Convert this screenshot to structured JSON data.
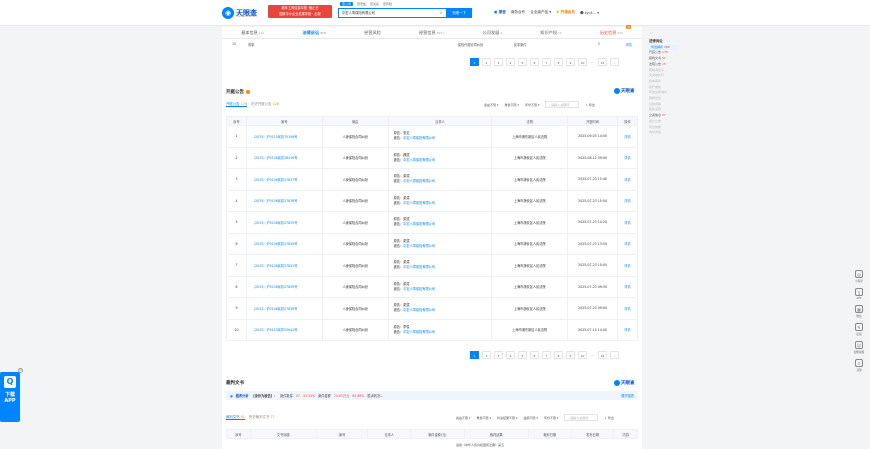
{
  "header": {
    "logo": "天眼查",
    "logo_sub": "TianYancha.com",
    "promo_line1": "新年工商信息年报 ·截止日",
    "promo_line2": "国家中小企业发展年报 · 必报",
    "search_tabs": [
      "查公司",
      "查老板",
      "查关系",
      "查风险"
    ],
    "search_value": "中宏人寿保险有限公司",
    "search_button": "天眼一下",
    "nav": {
      "report": "报告",
      "business": "商务合作",
      "products": "企业级产品",
      "vip": "开通会员",
      "user": "tyc4..."
    }
  },
  "tabs": [
    {
      "label": "基本信息",
      "count": "101"
    },
    {
      "label": "法律诉讼",
      "count": "315"
    },
    {
      "label": "经营风险",
      "count": ""
    },
    {
      "label": "经营信息",
      "count": "999+"
    },
    {
      "label": "公司发展",
      "count": "9"
    },
    {
      "label": "知识产权",
      "count": "10"
    },
    {
      "label": "历史信息",
      "count": "999"
    }
  ],
  "tab_hot": "热",
  "prev_row": {
    "num": "10",
    "case": "简单",
    "party": "保险代理合同纠纷",
    "status": "民事案件",
    "n": "3",
    "act": "详情"
  },
  "pager1": [
    "1",
    "2",
    "3",
    "4",
    "5",
    "6",
    "7",
    "8",
    "9",
    "10",
    "...",
    "15",
    "›"
  ],
  "hearing": {
    "title": "开庭公告",
    "brand": "天眼查",
    "subtabs": [
      {
        "label": "开庭公告",
        "count": "178"
      },
      {
        "label": "历史开庭公告",
        "count": "128"
      }
    ],
    "filters": [
      "案由不限",
      "角色不限",
      "年份不限"
    ],
    "search_placeholder": "请输入关键词",
    "export": "导出",
    "columns": [
      "序号",
      "案号",
      "案由",
      "当事人",
      "法院",
      "开庭时间",
      "操作"
    ],
    "rows": [
      {
        "n": "1",
        "case": "（2025）沪0115民初75199号",
        "reason": "人身保险合同纠纷",
        "plaintiff": "原告：张定",
        "defendant": "中宏人寿保险有限公司",
        "court": "上海市浦东新区人民法院",
        "time": "2025-09-03 14:00",
        "act": "详情"
      },
      {
        "n": "2",
        "case": "（2025）沪0106民初26416号",
        "reason": "人身保险合同纠纷",
        "plaintiff": "原告：魏斌",
        "defendant": "中宏人寿保险有限公司",
        "court": "上海市静安区人民法院",
        "time": "2025-08-12 09:00",
        "act": "详情"
      },
      {
        "n": "3",
        "case": "（2025）沪0106民初27837号",
        "reason": "人身保险合同纠纷",
        "plaintiff": "原告：梁斌",
        "defendant": "中宏人寿保险有限公司",
        "court": "上海市静安区人民法院",
        "time": "2025-07-23 15:40",
        "act": "详情"
      },
      {
        "n": "4",
        "case": "（2025）沪0106民初27836号",
        "reason": "人身保险合同纠纷",
        "plaintiff": "原告：梁斌",
        "defendant": "中宏人寿保险有限公司",
        "court": "上海市静安区人民法院",
        "time": "2025-07-23 15:00",
        "act": "详情"
      },
      {
        "n": "5",
        "case": "（2025）沪0106民初27835号",
        "reason": "人身保险合同纠纷",
        "plaintiff": "原告：梁斌",
        "defendant": "中宏人寿保险有限公司",
        "court": "上海市静安区人民法院",
        "time": "2025-07-23 14:20",
        "act": "详情"
      },
      {
        "n": "6",
        "case": "（2025）沪0106民初27834号",
        "reason": "人身保险合同纠纷",
        "plaintiff": "原告：梁斌",
        "defendant": "中宏人寿保险有限公司",
        "court": "上海市静安区人民法院",
        "time": "2025-07-23 13:50",
        "act": "详情"
      },
      {
        "n": "7",
        "case": "（2025）沪0106民初27832号",
        "reason": "人身保险合同纠纷",
        "plaintiff": "原告：梁斌",
        "defendant": "中宏人寿保险有限公司",
        "court": "上海市静安区人民法院",
        "time": "2025-07-23 10:00",
        "act": "详情"
      },
      {
        "n": "8",
        "case": "（2025）沪0106民初27839号",
        "reason": "人身保险合同纠纷",
        "plaintiff": "原告：梁斌",
        "defendant": "中宏人寿保险有限公司",
        "court": "上海市静安区人民法院",
        "time": "2025-07-23 09:30",
        "act": "详情"
      },
      {
        "n": "9",
        "case": "（2025）沪0106民初27838号",
        "reason": "人身保险合同纠纷",
        "plaintiff": "原告：梁斌",
        "defendant": "中宏人寿保险有限公司",
        "court": "上海市静安区人民法院",
        "time": "2025-07-23 09:00",
        "act": "详情"
      },
      {
        "n": "10",
        "case": "（2025）沪0115民初55644号",
        "reason": "人身保险合同纠纷",
        "plaintiff": "原告：李俊",
        "defendant": "中宏人寿保险有限公司",
        "court": "上海市浦东新区人民法院",
        "time": "2025-07-14 14:00",
        "act": "详情"
      }
    ],
    "defendant_prefix": "被告："
  },
  "pager2": [
    "1",
    "2",
    "3",
    "4",
    "5",
    "6",
    "7",
    "8",
    "9",
    "10",
    "...",
    "24",
    "›"
  ],
  "judgment": {
    "title": "裁判文书",
    "brand": "天眼查",
    "banner": {
      "tag": "图表分析",
      "label": "【身份为被告】：",
      "count_text": "案件数量",
      "count": "47",
      "pct1": "43.34%",
      "amount_text": "案件金额",
      "amount": "74.67万元",
      "pct2": "63.86%",
      "tail": "胜诉判决...",
      "more": "展开图表"
    },
    "subtabs": [
      {
        "label": "裁判文书",
        "count": "91"
      },
      {
        "label": "历史裁判文书",
        "count": "77"
      }
    ],
    "filters": [
      "案由不限",
      "角色不限",
      "判决结果不限",
      "金额不限",
      "年份不限"
    ],
    "search_placeholder": "请输入关键词",
    "export": "导出",
    "columns": [
      "序号",
      "文书标题",
      "案号",
      "当事人",
      "案件金额(元)",
      "裁判结果",
      "裁判日期",
      "发布日期",
      "内容"
    ],
    "footnote": "适用《中华人民共和国民法典》第五"
  },
  "sidebar": {
    "title": "法律诉讼",
    "items": [
      {
        "label": "司法解析",
        "count": "289",
        "state": "on"
      },
      {
        "label": "开庭公告",
        "count": "178",
        "state": "blk"
      },
      {
        "label": "裁判文书",
        "count": "91",
        "state": "blk"
      },
      {
        "label": "法院公告",
        "count": "15",
        "state": "blk"
      },
      {
        "label": "限制消费令",
        "count": "",
        "state": "dim"
      },
      {
        "label": "失信被执行",
        "count": "",
        "state": "dim"
      },
      {
        "label": "终本案件",
        "count": "",
        "state": "dim"
      },
      {
        "label": "破产重整",
        "count": "",
        "state": "dim"
      },
      {
        "label": "司法拍卖询价",
        "count": "",
        "state": "dim"
      },
      {
        "label": "限制出境",
        "count": "",
        "state": "dim"
      },
      {
        "label": "诉前调解",
        "count": "",
        "state": "dim"
      },
      {
        "label": "股权冻结",
        "count": "",
        "state": "dim"
      },
      {
        "label": "立案信息",
        "count": "27",
        "state": "blk"
      },
      {
        "label": "送达公告",
        "count": "",
        "state": "dim"
      },
      {
        "label": "司法协助",
        "count": "",
        "state": "dim"
      },
      {
        "label": "询价评估",
        "count": "",
        "state": "dim"
      }
    ]
  },
  "right_tools": [
    {
      "icon": "◎",
      "label": "小程序"
    },
    {
      "icon": "▯",
      "label": "APP"
    },
    {
      "icon": "▦",
      "label": "微信"
    },
    {
      "icon": "✎",
      "label": "反馈"
    },
    {
      "icon": "☺",
      "label": "智能客服"
    },
    {
      "icon": "⇧",
      "label": "顶部"
    }
  ],
  "app_tab": {
    "q": "Q",
    "line1": "下载",
    "line2": "APP",
    "close": "×"
  }
}
